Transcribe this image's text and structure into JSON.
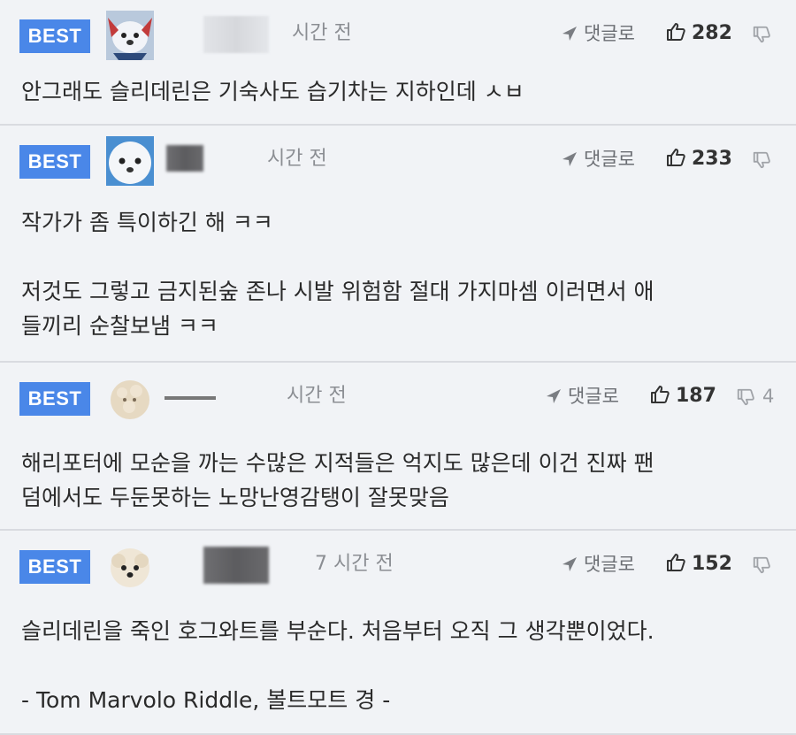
{
  "comments": [
    {
      "badge": "BEST",
      "time": "시간 전",
      "reply_label": "댓글로",
      "likes": "282",
      "dislikes": "",
      "lines": [
        "안그래도 슬리데린은 기숙사도 습기차는 지하인데 ㅅㅂ"
      ]
    },
    {
      "badge": "BEST",
      "time": "시간 전",
      "reply_label": "댓글로",
      "likes": "233",
      "dislikes": "",
      "lines": [
        "작가가 좀 특이하긴 해 ㅋㅋ",
        "",
        "저것도 그렇고 금지된숲 존나 시발 위험함 절대 가지마셈 이러면서 애",
        "들끼리 순찰보냄 ㅋㅋ"
      ]
    },
    {
      "badge": "BEST",
      "time": "시간 전",
      "reply_label": "댓글로",
      "likes": "187",
      "dislikes": "4",
      "lines": [
        "해리포터에 모순을 까는 수많은 지적들은 억지도 많은데 이건 진짜 팬",
        "덤에서도 두둔못하는 노망난영감탱이 잘못맞음"
      ]
    },
    {
      "badge": "BEST",
      "time": "7 시간 전",
      "reply_label": "댓글로",
      "likes": "152",
      "dislikes": "",
      "lines": [
        "슬리데린을 죽인 호그와트를 부순다. 처음부터 오직 그 생각뿐이었다.",
        "",
        "- Tom Marvolo Riddle, 볼트모트 경 -"
      ]
    }
  ]
}
